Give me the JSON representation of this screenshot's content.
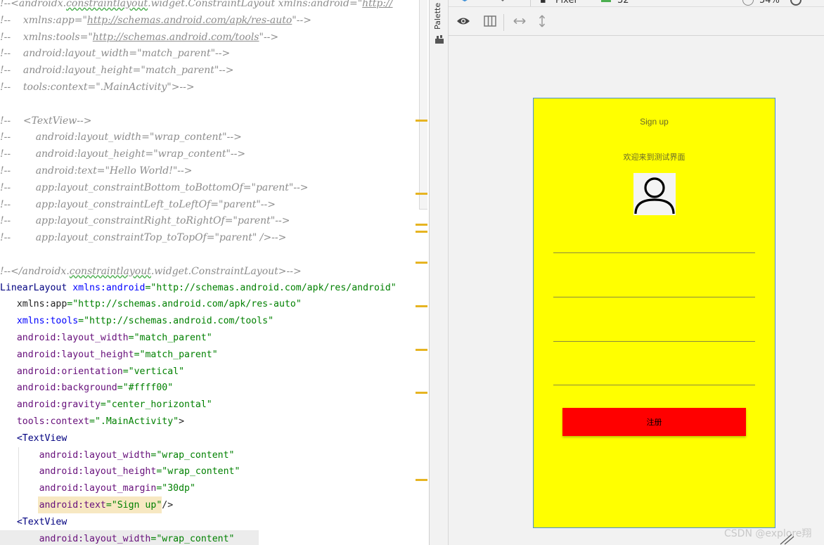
{
  "editor": {
    "comment_lines": [
      {
        "prefix": "!--",
        "text": "<androidx.",
        "link": "constraintlayout",
        "rest": ".widget.ConstraintLayout xmlns:android=\"",
        "url": "http://"
      },
      {
        "prefix": "!--",
        "text": "    xmlns:app=\"",
        "url": "http://schemas.android.com/apk/res-auto",
        "rest": "\"-->"
      },
      {
        "prefix": "!--",
        "text": "    xmlns:tools=\"",
        "url": "http://schemas.android.com/tools",
        "rest": "\"-->"
      },
      {
        "prefix": "!--",
        "text": "    android:layout_width=\"match_parent\"-->"
      },
      {
        "prefix": "!--",
        "text": "    android:layout_height=\"match_parent\"-->"
      },
      {
        "prefix": "!--",
        "text": "    tools:context=\".MainActivity\">-->"
      },
      {
        "prefix": "",
        "text": ""
      },
      {
        "prefix": "!--",
        "text": "    <TextView-->"
      },
      {
        "prefix": "!--",
        "text": "        android:layout_width=\"wrap_content\"-->"
      },
      {
        "prefix": "!--",
        "text": "        android:layout_height=\"wrap_content\"-->"
      },
      {
        "prefix": "!--",
        "text": "        android:text=\"Hello World!\"-->"
      },
      {
        "prefix": "!--",
        "text": "        app:layout_constraintBottom_toBottomOf=\"parent\"-->"
      },
      {
        "prefix": "!--",
        "text": "        app:layout_constraintLeft_toLeftOf=\"parent\"-->"
      },
      {
        "prefix": "!--",
        "text": "        app:layout_constraintRight_toRightOf=\"parent\"-->"
      },
      {
        "prefix": "!--",
        "text": "        app:layout_constraintTop_toTopOf=\"parent\" />-->"
      },
      {
        "prefix": "",
        "text": ""
      },
      {
        "prefix": "!--",
        "text": "</androidx.",
        "link": "constraintlayout",
        "rest": ".widget.ConstraintLayout>-->"
      }
    ],
    "xml_lines": [
      {
        "tag": "LinearLayout",
        "ns": " xmlns:android",
        "val": "=\"http://schemas.android.com/apk/res/android\""
      },
      {
        "indent": "   ",
        "plain": "xmlns:app",
        "val": "=\"http://schemas.android.com/apk/res-auto\""
      },
      {
        "indent": "   ",
        "ns": "xmlns:tools",
        "val": "=\"http://schemas.android.com/tools\""
      },
      {
        "indent": "   ",
        "attr": "android:layout_width",
        "val": "=\"match_parent\""
      },
      {
        "indent": "   ",
        "attr": "android:layout_height",
        "val": "=\"match_parent\""
      },
      {
        "indent": "   ",
        "attr": "android:orientation",
        "val": "=\"vertical\""
      },
      {
        "indent": "   ",
        "attr": "android:background",
        "val": "=\"#ffff00\""
      },
      {
        "indent": "   ",
        "attr": "android:gravity",
        "val": "=\"center_horizontal\""
      },
      {
        "indent": "   ",
        "attr": "tools:context",
        "val": "=\".MainActivity\"",
        "end": ">"
      },
      {
        "indent": "   ",
        "tag": "<TextView"
      },
      {
        "indent": "       ",
        "attr": "android:layout_width",
        "val": "=\"wrap_content\""
      },
      {
        "indent": "       ",
        "attr": "android:layout_height",
        "val": "=\"wrap_content\""
      },
      {
        "indent": "       ",
        "attr": "android:layout_margin",
        "val": "=\"30dp\""
      },
      {
        "indent": "       ",
        "attr": "android:text",
        "val": "=\"Sign up\"",
        "end": "/>"
      },
      {
        "indent": "   ",
        "tag": "<TextView"
      },
      {
        "indent": "       ",
        "attr": "android:layout_width",
        "val": "=\"wrap_content\""
      }
    ]
  },
  "palette": {
    "label": "Palette"
  },
  "toolbar": {
    "device": "Pixel",
    "api": "32",
    "zoom": "54%"
  },
  "preview": {
    "background": "#ffff00",
    "signup_text": "Sign up",
    "welcome_text": "欢迎来到测试界面",
    "register_label": "注册",
    "register_color": "#ff0000"
  },
  "watermark": "CSDN @explore翔"
}
